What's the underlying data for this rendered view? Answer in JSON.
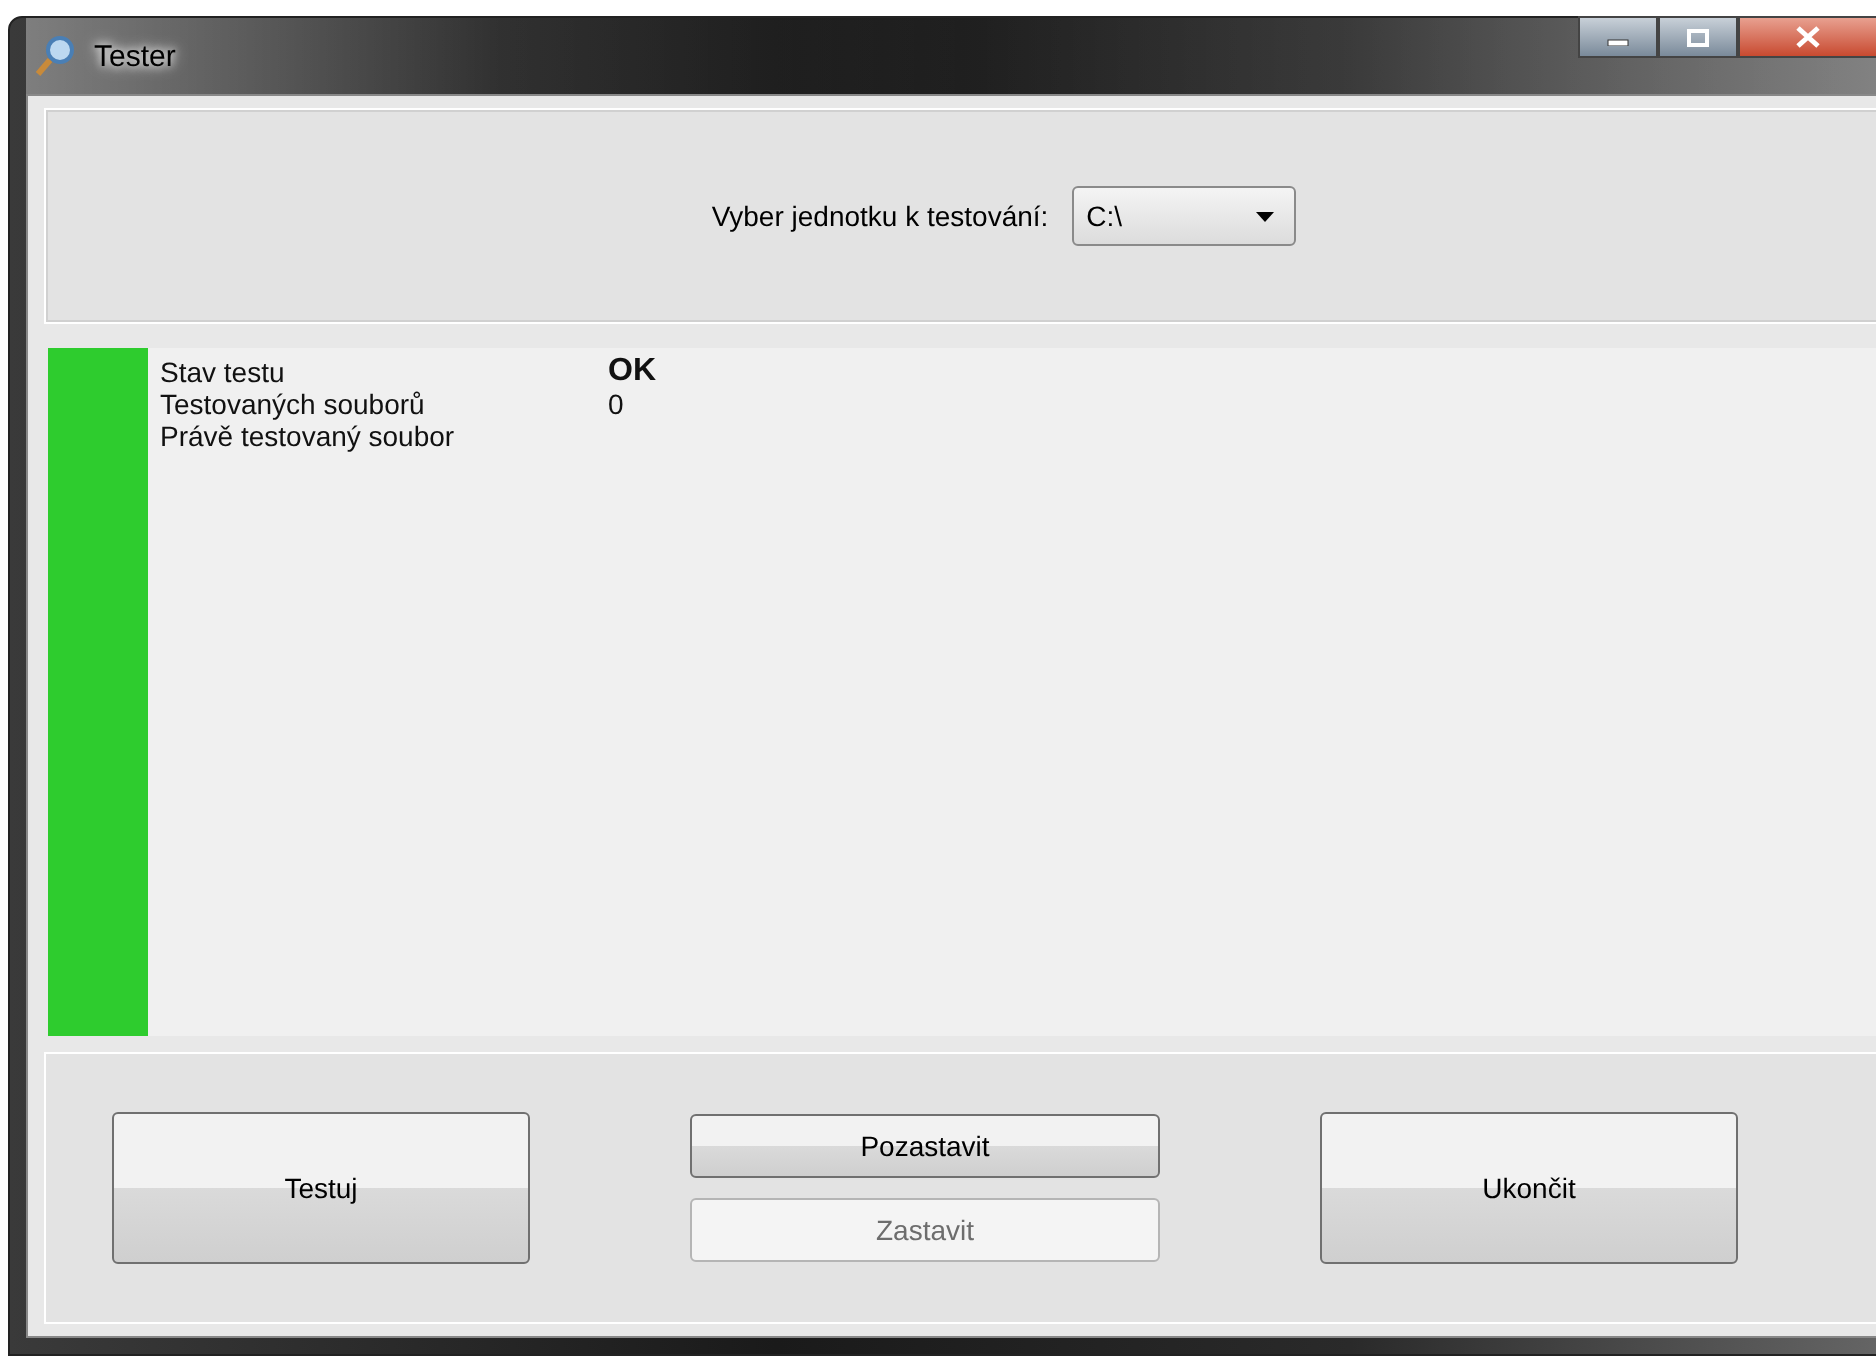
{
  "window": {
    "title": "Tester"
  },
  "drive_select": {
    "label": "Vyber jednotku k testování:",
    "value": "C:\\"
  },
  "status": {
    "passed": true,
    "rows": [
      {
        "label": "Stav testu",
        "value": "OK"
      },
      {
        "label": "Testovaných souborů",
        "value": "0"
      },
      {
        "label": "Právě testovaný soubor"
      }
    ]
  },
  "buttons": [
    {
      "label": "Testuj",
      "kind": "large",
      "disabled": false
    },
    {
      "label": "Pozastavit",
      "kind": "small",
      "disabled": false
    },
    {
      "label": "Zastavit",
      "kind": "small",
      "disabled": true
    },
    {
      "label": "Ukončit",
      "kind": "large",
      "disabled": false
    }
  ]
}
